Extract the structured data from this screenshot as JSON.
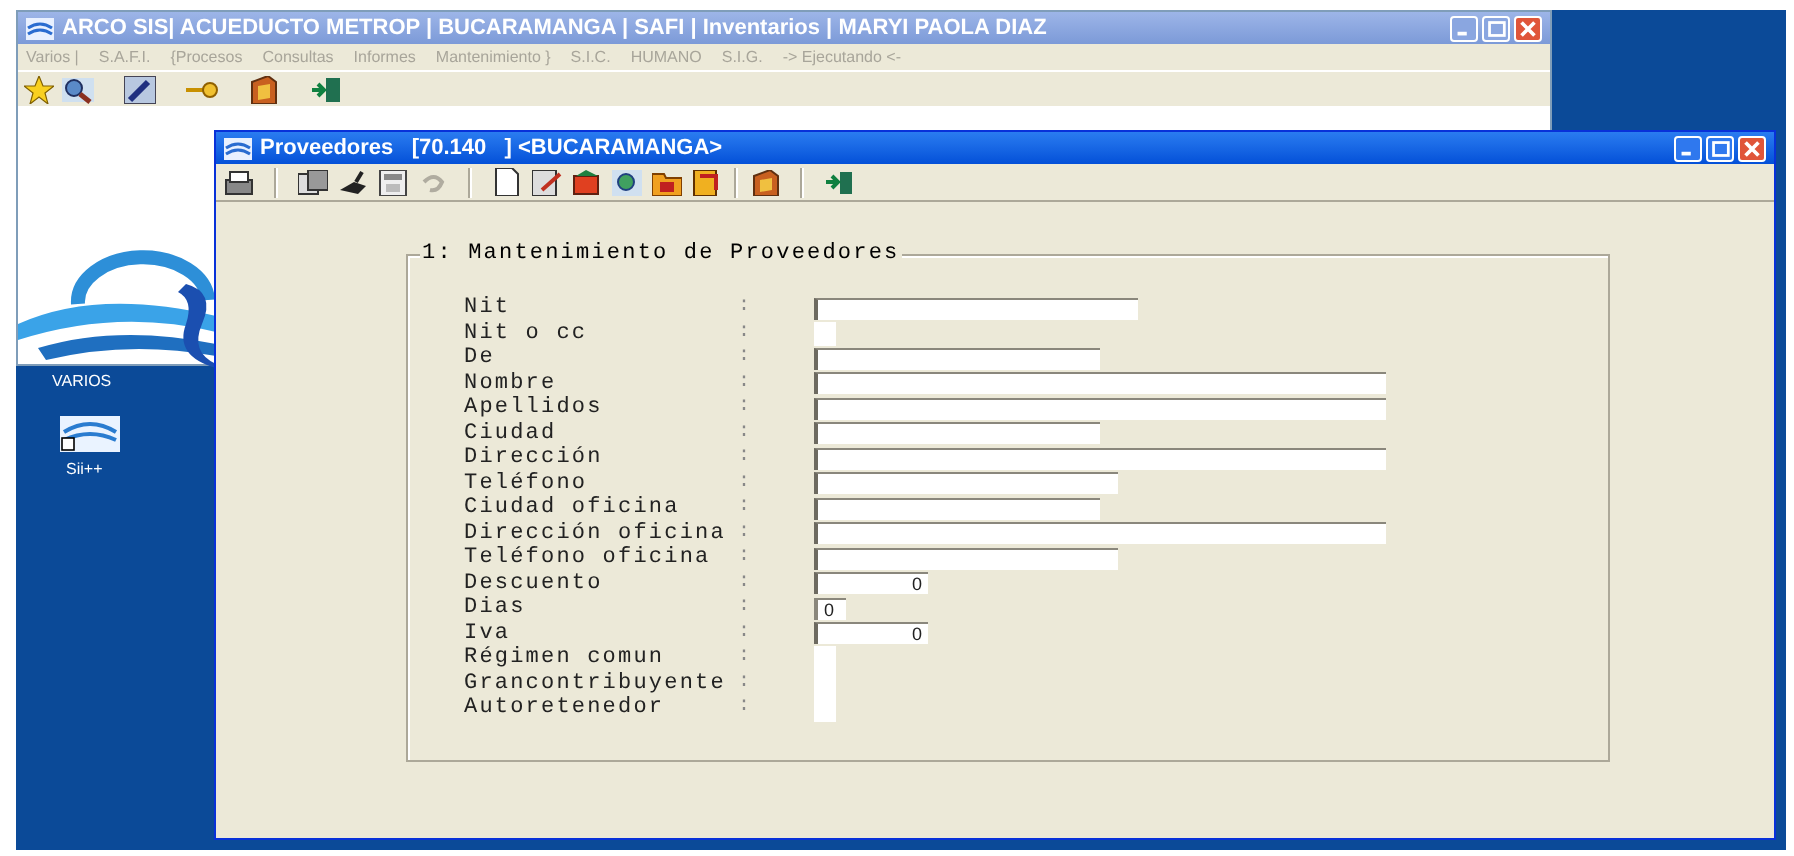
{
  "main_window": {
    "title": "ARCO SIS| ACUEDUCTO METROP | BUCARAMANGA | SAFI | Inventarios | MARYI PAOLA DIAZ",
    "menu": [
      {
        "label": "Varios |",
        "disabled": true
      },
      {
        "label": "S.A.F.I.",
        "disabled": true
      },
      {
        "label": "{Procesos",
        "disabled": true
      },
      {
        "label": "Consultas",
        "disabled": true
      },
      {
        "label": "Informes",
        "disabled": true
      },
      {
        "label": "Mantenimiento }",
        "disabled": true
      },
      {
        "label": "S.I.C.",
        "disabled": true
      },
      {
        "label": "HUMANO",
        "disabled": true
      },
      {
        "label": "S.I.G.",
        "disabled": true
      },
      {
        "label": "-> Ejecutando <-",
        "disabled": true
      }
    ]
  },
  "desktop_icons": [
    {
      "label": "VARIOS"
    },
    {
      "label": "Sii++"
    }
  ],
  "form_window": {
    "title": "Proveedores",
    "code": "[70.140   ]",
    "location": "<BUCARAMANGA>",
    "group_title": "1: Mantenimiento de Proveedores",
    "fields": [
      {
        "label": "Nit",
        "separator": ":"
      },
      {
        "label": "Nit o cc",
        "separator": ":"
      },
      {
        "label": "De",
        "separator": ":"
      },
      {
        "label": "Nombre",
        "separator": ":"
      },
      {
        "label": "Apellidos",
        "separator": ":"
      },
      {
        "label": "Ciudad",
        "separator": ":"
      },
      {
        "label": "Dirección",
        "separator": ":"
      },
      {
        "label": "Teléfono",
        "separator": ":"
      },
      {
        "label": "Ciudad oficina",
        "separator": ":"
      },
      {
        "label": "Dirección oficina",
        "separator": ":"
      },
      {
        "label": "Teléfono oficina",
        "separator": ":"
      },
      {
        "label": "Descuento",
        "separator": ":",
        "value": "0"
      },
      {
        "label": "Dias",
        "separator": ":",
        "value": "0"
      },
      {
        "label": "Iva",
        "separator": ":",
        "value": "0"
      },
      {
        "label": "Régimen comun",
        "separator": ":"
      },
      {
        "label": "Grancontribuyente",
        "separator": ":"
      },
      {
        "label": "Autoretenedor",
        "separator": ":"
      }
    ]
  }
}
